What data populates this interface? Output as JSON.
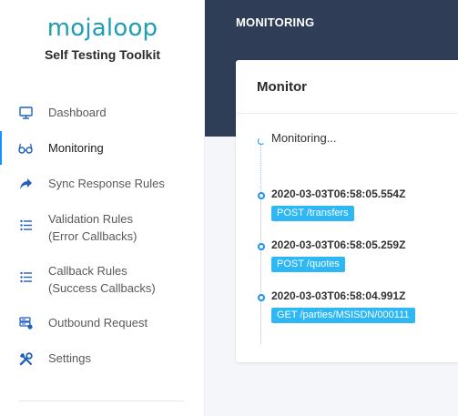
{
  "brand": {
    "logo_text": "mojaloop",
    "app_title": "Self Testing Toolkit",
    "accent": "#1f9db2"
  },
  "sidebar": {
    "items": [
      {
        "label": "Dashboard",
        "icon": "monitor-icon"
      },
      {
        "label": "Monitoring",
        "icon": "glasses-icon",
        "active": true
      },
      {
        "label": "Sync Response Rules",
        "icon": "share-arrow-icon"
      },
      {
        "label_line1": "Validation Rules",
        "label_line2": "(Error Callbacks)",
        "icon": "list-icon"
      },
      {
        "label_line1": "Callback Rules",
        "label_line2": "(Success Callbacks)",
        "icon": "list-icon"
      },
      {
        "label": "Outbound Request",
        "icon": "server-icon"
      },
      {
        "label": "Settings",
        "icon": "tools-icon"
      }
    ]
  },
  "header": {
    "title": "MONITORING",
    "bg": "#2f3d56"
  },
  "monitor": {
    "title": "Monitor",
    "pending_text": "Monitoring...",
    "events": [
      {
        "timestamp": "2020-03-03T06:58:05.554Z",
        "tag": "POST /transfers"
      },
      {
        "timestamp": "2020-03-03T06:58:05.259Z",
        "tag": "POST /quotes"
      },
      {
        "timestamp": "2020-03-03T06:58:04.991Z",
        "tag": "GET /parties/MSISDN/000111"
      }
    ],
    "tag_color": "#2db7f5"
  }
}
